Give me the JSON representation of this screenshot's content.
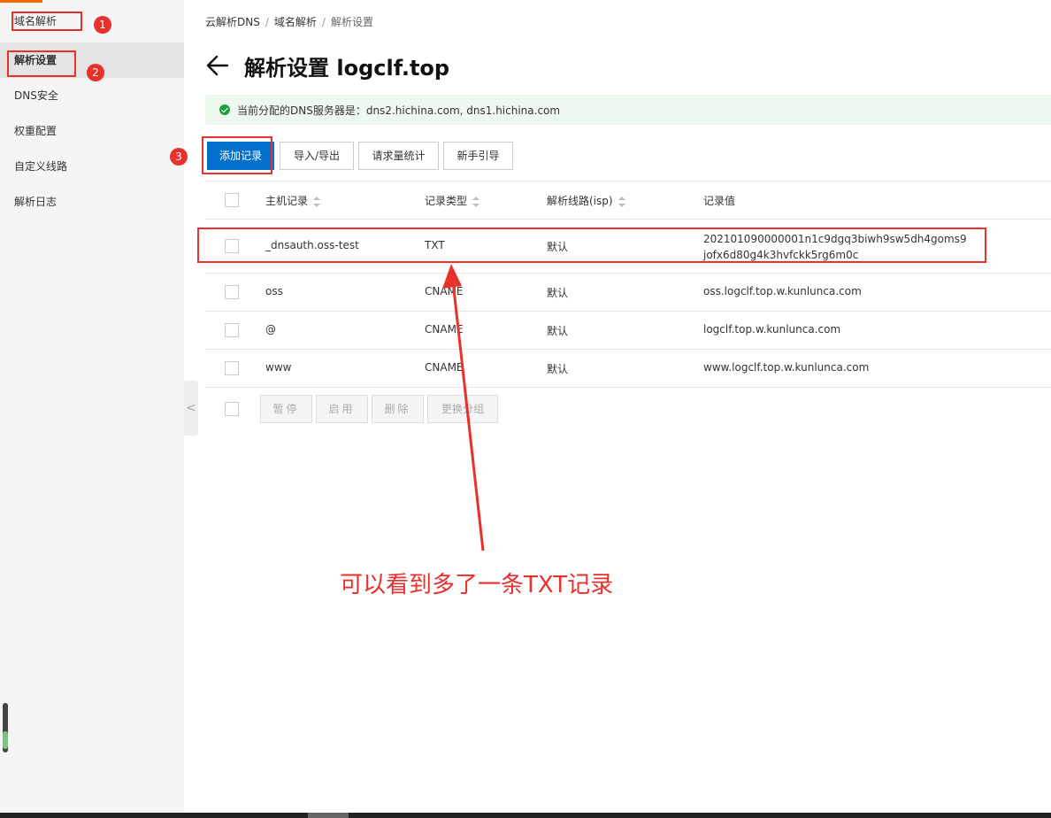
{
  "sidebar": {
    "items": [
      {
        "label": "域名解析"
      },
      {
        "label": "解析设置"
      },
      {
        "label": "DNS安全"
      },
      {
        "label": "权重配置"
      },
      {
        "label": "自定义线路"
      },
      {
        "label": "解析日志"
      }
    ],
    "collapse_glyph": "<"
  },
  "annotations": {
    "markers": [
      "1",
      "2",
      "3"
    ],
    "note": "可以看到多了一条TXT记录",
    "color": "#e8312d"
  },
  "breadcrumb": {
    "items": [
      "云解析DNS",
      "域名解析",
      "解析设置"
    ],
    "separator": "/"
  },
  "page": {
    "title": "解析设置 logclf.top"
  },
  "notice": {
    "text": "当前分配的DNS服务器是：dns2.hichina.com, dns1.hichina.com"
  },
  "toolbar": {
    "add_record": "添加记录",
    "import_export": "导入/导出",
    "request_stats": "请求量统计",
    "guide": "新手引导"
  },
  "table": {
    "headers": {
      "host": "主机记录",
      "type": "记录类型",
      "line": "解析线路(isp)",
      "value": "记录值"
    },
    "rows": [
      {
        "host": "_dnsauth.oss-test",
        "type": "TXT",
        "line": "默认",
        "value": "202101090000001n1c9dgq3biwh9sw5dh4goms9jofx6d80g4k3hvfckk5rg6m0c"
      },
      {
        "host": "oss",
        "type": "CNAME",
        "line": "默认",
        "value": "oss.logclf.top.w.kunlunca.com"
      },
      {
        "host": "@",
        "type": "CNAME",
        "line": "默认",
        "value": "logclf.top.w.kunlunca.com"
      },
      {
        "host": "www",
        "type": "CNAME",
        "line": "默认",
        "value": "www.logclf.top.w.kunlunca.com"
      }
    ]
  },
  "batch": {
    "pause": "暂停",
    "enable": "启用",
    "delete": "删除",
    "change_group": "更换分组"
  },
  "colors": {
    "primary": "#0070cc",
    "success": "#1e9e3e",
    "accent": "#ff6a00"
  }
}
